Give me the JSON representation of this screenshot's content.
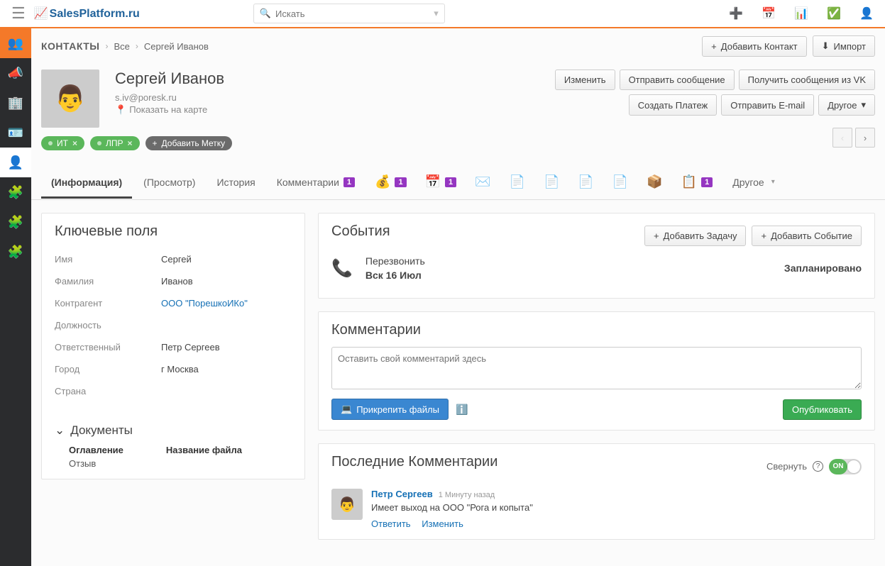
{
  "header": {
    "logo": "SalesPlatform.ru",
    "search_placeholder": "Искать"
  },
  "breadcrumb": {
    "module": "КОНТАКТЫ",
    "all": "Все",
    "current": "Сергей Иванов"
  },
  "topbuttons": {
    "add_contact": "Добавить Контакт",
    "import": "Импорт"
  },
  "profile": {
    "name": "Сергей Иванов",
    "email": "s.iv@poresk.ru",
    "map": "Показать на карте"
  },
  "actions": {
    "edit": "Изменить",
    "send_msg": "Отправить сообщение",
    "get_vk": "Получить сообщения из VK",
    "create_pay": "Создать Платеж",
    "send_email": "Отправить E-mail",
    "more": "Другое"
  },
  "tags": {
    "t1": "ИТ",
    "t2": "ЛПР",
    "add": "Добавить Метку"
  },
  "tabs": {
    "info": "(Информация)",
    "view": "(Просмотр)",
    "history": "История",
    "comments": "Комментарии",
    "badge1": "1",
    "badge2": "1",
    "badge3": "1",
    "badge4": "1",
    "more": "Другое"
  },
  "keyfields": {
    "title": "Ключевые поля",
    "name_k": "Имя",
    "name_v": "Сергей",
    "surname_k": "Фамилия",
    "surname_v": "Иванов",
    "account_k": "Контрагент",
    "account_v": "ООО \"ПорешкоИКо\"",
    "position_k": "Должность",
    "position_v": "",
    "owner_k": "Ответственный",
    "owner_v": "Петр Сергеев",
    "city_k": "Город",
    "city_v": "г Москва",
    "country_k": "Страна",
    "country_v": ""
  },
  "docs": {
    "title": "Документы",
    "col1": "Оглавление",
    "col2": "Название файла",
    "row1": "Отзыв"
  },
  "events": {
    "title": "События",
    "add_task": "Добавить Задачу",
    "add_event": "Добавить Событие",
    "item_title": "Перезвонить",
    "item_date": "Вск 16 Июл",
    "item_status": "Запланировано"
  },
  "comments": {
    "title": "Комментарии",
    "placeholder": "Оставить свой комментарий здесь",
    "attach": "Прикрепить файлы",
    "publish": "Опубликовать"
  },
  "recent": {
    "title": "Последние Комментарии",
    "collapse": "Свернуть",
    "toggle": "ON",
    "author": "Петр Сергеев",
    "time": "1 Минуту назад",
    "text": "Имеет выход на ООО \"Рога и копыта\"",
    "reply": "Ответить",
    "edit": "Изменить"
  }
}
